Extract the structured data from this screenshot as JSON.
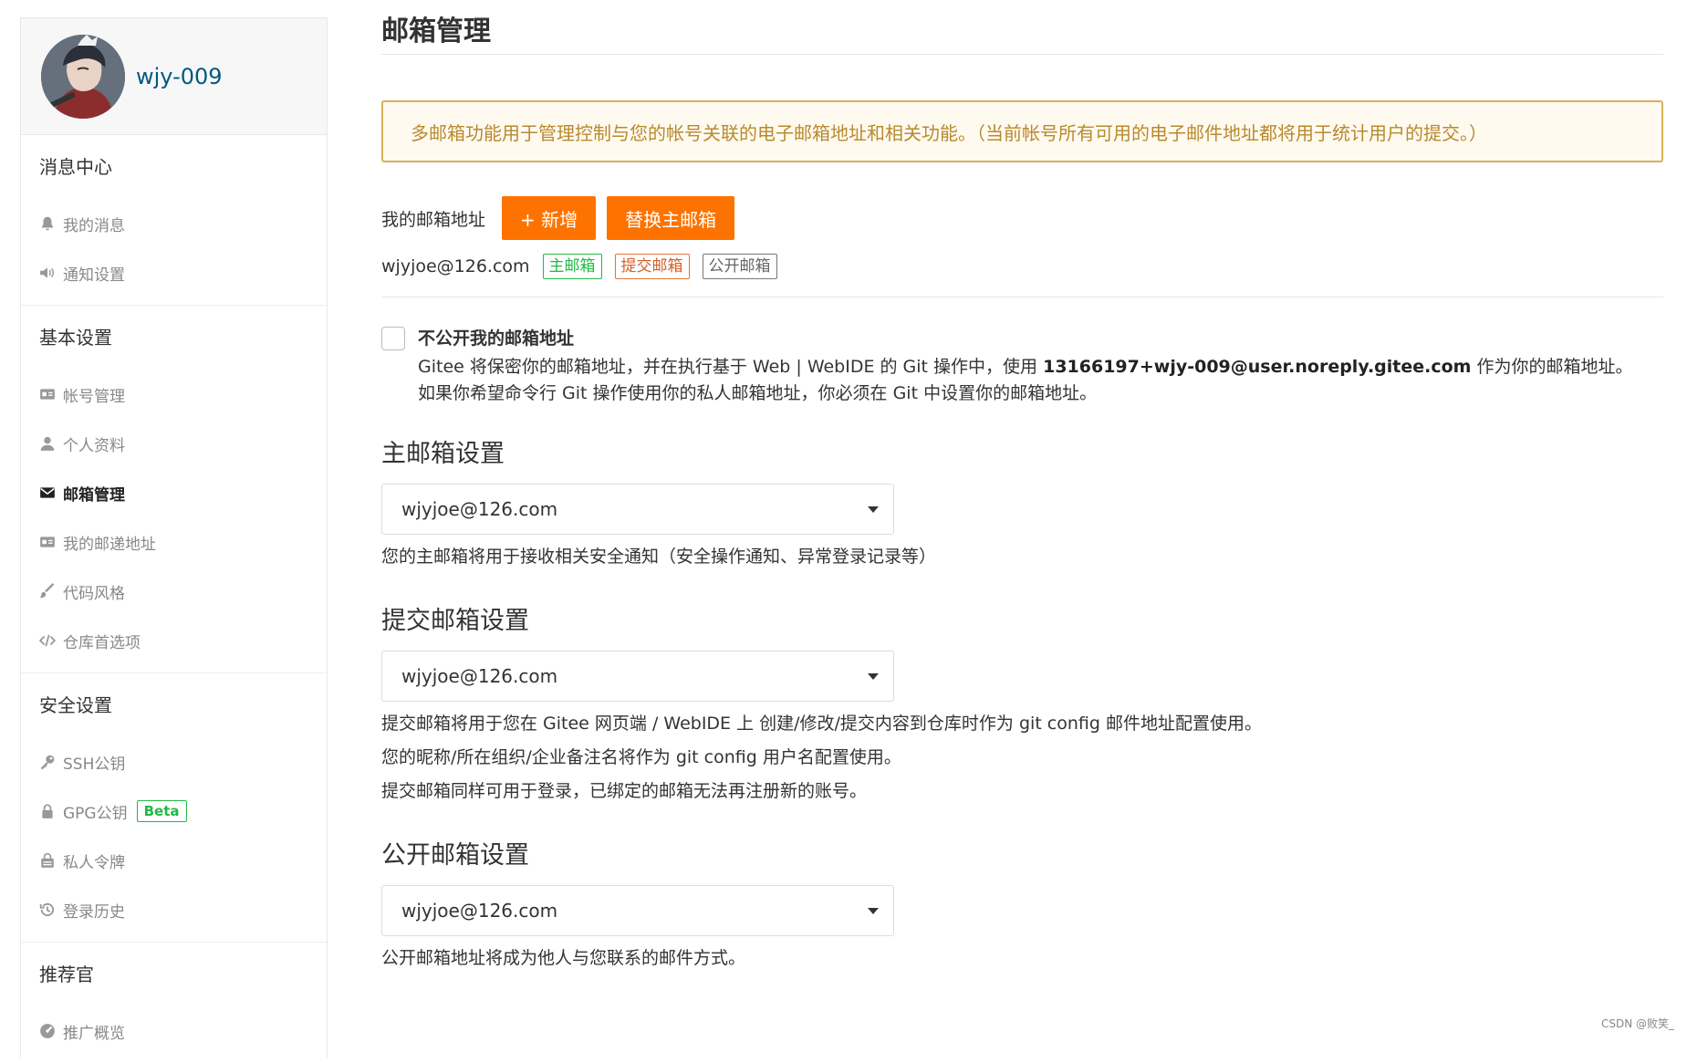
{
  "sidebar": {
    "username": "wjy-009",
    "sections": [
      {
        "title": "消息中心",
        "items": [
          {
            "label": "我的消息",
            "icon": "bell-icon"
          },
          {
            "label": "通知设置",
            "icon": "speaker-icon"
          }
        ]
      },
      {
        "title": "基本设置",
        "items": [
          {
            "label": "帐号管理",
            "icon": "id-card-icon"
          },
          {
            "label": "个人资料",
            "icon": "user-icon"
          },
          {
            "label": "邮箱管理",
            "icon": "envelope-icon",
            "active": true
          },
          {
            "label": "我的邮递地址",
            "icon": "address-card-icon"
          },
          {
            "label": "代码风格",
            "icon": "brush-icon"
          },
          {
            "label": "仓库首选项",
            "icon": "code-icon"
          }
        ]
      },
      {
        "title": "安全设置",
        "items": [
          {
            "label": "SSH公钥",
            "icon": "key-icon"
          },
          {
            "label": "GPG公钥",
            "icon": "lock-icon",
            "badge": "Beta"
          },
          {
            "label": "私人令牌",
            "icon": "token-icon"
          },
          {
            "label": "登录历史",
            "icon": "history-icon"
          }
        ]
      },
      {
        "title": "推荐官",
        "items": [
          {
            "label": "推广概览",
            "icon": "gauge-icon"
          }
        ]
      }
    ]
  },
  "main": {
    "title": "邮箱管理",
    "notice": "多邮箱功能用于管理控制与您的帐号关联的电子邮箱地址和相关功能。（当前帐号所有可用的电子邮件地址都将用于统计用户的提交。）",
    "address_label": "我的邮箱地址",
    "add_button": "+ 新增",
    "replace_button": "替换主邮箱",
    "email": "wjyjoe@126.com",
    "tags": {
      "primary": "主邮箱",
      "commit": "提交邮箱",
      "public": "公开邮箱"
    },
    "privacy": {
      "title": "不公开我的邮箱地址",
      "desc_prefix": "Gitee 将保密你的邮箱地址，并在执行基于 Web | WebIDE 的 Git 操作中，使用 ",
      "noreply_email": "13166197+wjy-009@user.noreply.gitee.com",
      "desc_suffix": " 作为你的邮箱地址。",
      "desc_line2": "如果你希望命令行 Git 操作使用你的私人邮箱地址，你必须在 Git 中设置你的邮箱地址。"
    },
    "primary_setting": {
      "title": "主邮箱设置",
      "value": "wjyjoe@126.com",
      "help": "您的主邮箱将用于接收相关安全通知（安全操作通知、异常登录记录等）"
    },
    "commit_setting": {
      "title": "提交邮箱设置",
      "value": "wjyjoe@126.com",
      "help": [
        "提交邮箱将用于您在 Gitee 网页端 / WebIDE 上 创建/修改/提交内容到仓库时作为 git config 邮件地址配置使用。",
        "您的昵称/所在组织/企业备注名将作为 git config 用户名配置使用。",
        "提交邮箱同样可用于登录，已绑定的邮箱无法再注册新的账号。"
      ]
    },
    "public_setting": {
      "title": "公开邮箱设置",
      "value": "wjyjoe@126.com",
      "help": "公开邮箱地址将成为他人与您联系的邮件方式。"
    }
  },
  "watermark": "CSDN @败笑_",
  "colors": {
    "accent": "#fe7300",
    "link": "#005980",
    "success": "#21ba45",
    "notice_border": "#d9b05a"
  }
}
